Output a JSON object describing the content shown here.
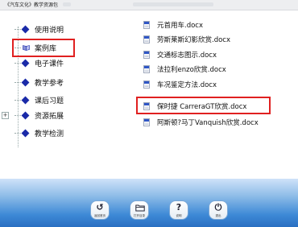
{
  "window": {
    "title": "《汽车文化》教学资源包"
  },
  "tree": {
    "items": [
      {
        "label": "使用说明",
        "icon": "diamond-bullet-icon"
      },
      {
        "label": "案例库",
        "icon": "open-book-icon"
      },
      {
        "label": "电子课件",
        "icon": "diamond-bullet-icon"
      },
      {
        "label": "教学参考",
        "icon": "diamond-bullet-icon"
      },
      {
        "label": "课后习题",
        "icon": "diamond-bullet-icon"
      },
      {
        "label": "资源拓展",
        "icon": "diamond-bullet-icon"
      },
      {
        "label": "教学检测",
        "icon": "diamond-bullet-icon"
      }
    ],
    "expander": "+"
  },
  "files": [
    {
      "name": "元首用车.docx"
    },
    {
      "name": "劳斯莱斯幻影欣赏.docx"
    },
    {
      "name": "交通标志图示.docx"
    },
    {
      "name": "法拉利enzo欣赏.docx"
    },
    {
      "name": "车况鉴定方法.docx"
    },
    {
      "name": "保时捷 CarreraGT欣赏.docx"
    },
    {
      "name": "阿斯顿?马丁Vanquish欣赏.docx"
    }
  ],
  "toolbar": {
    "back": {
      "glyph": "↺",
      "caption": "返回首页"
    },
    "folder": {
      "caption": "打开目录"
    },
    "help": {
      "glyph": "?",
      "caption": "说明"
    },
    "exit": {
      "glyph": "⏻",
      "caption": "退出"
    }
  },
  "colors": {
    "highlight": "#e02020",
    "bullet": "#1a2aa8",
    "footer": "#3d89d6"
  }
}
